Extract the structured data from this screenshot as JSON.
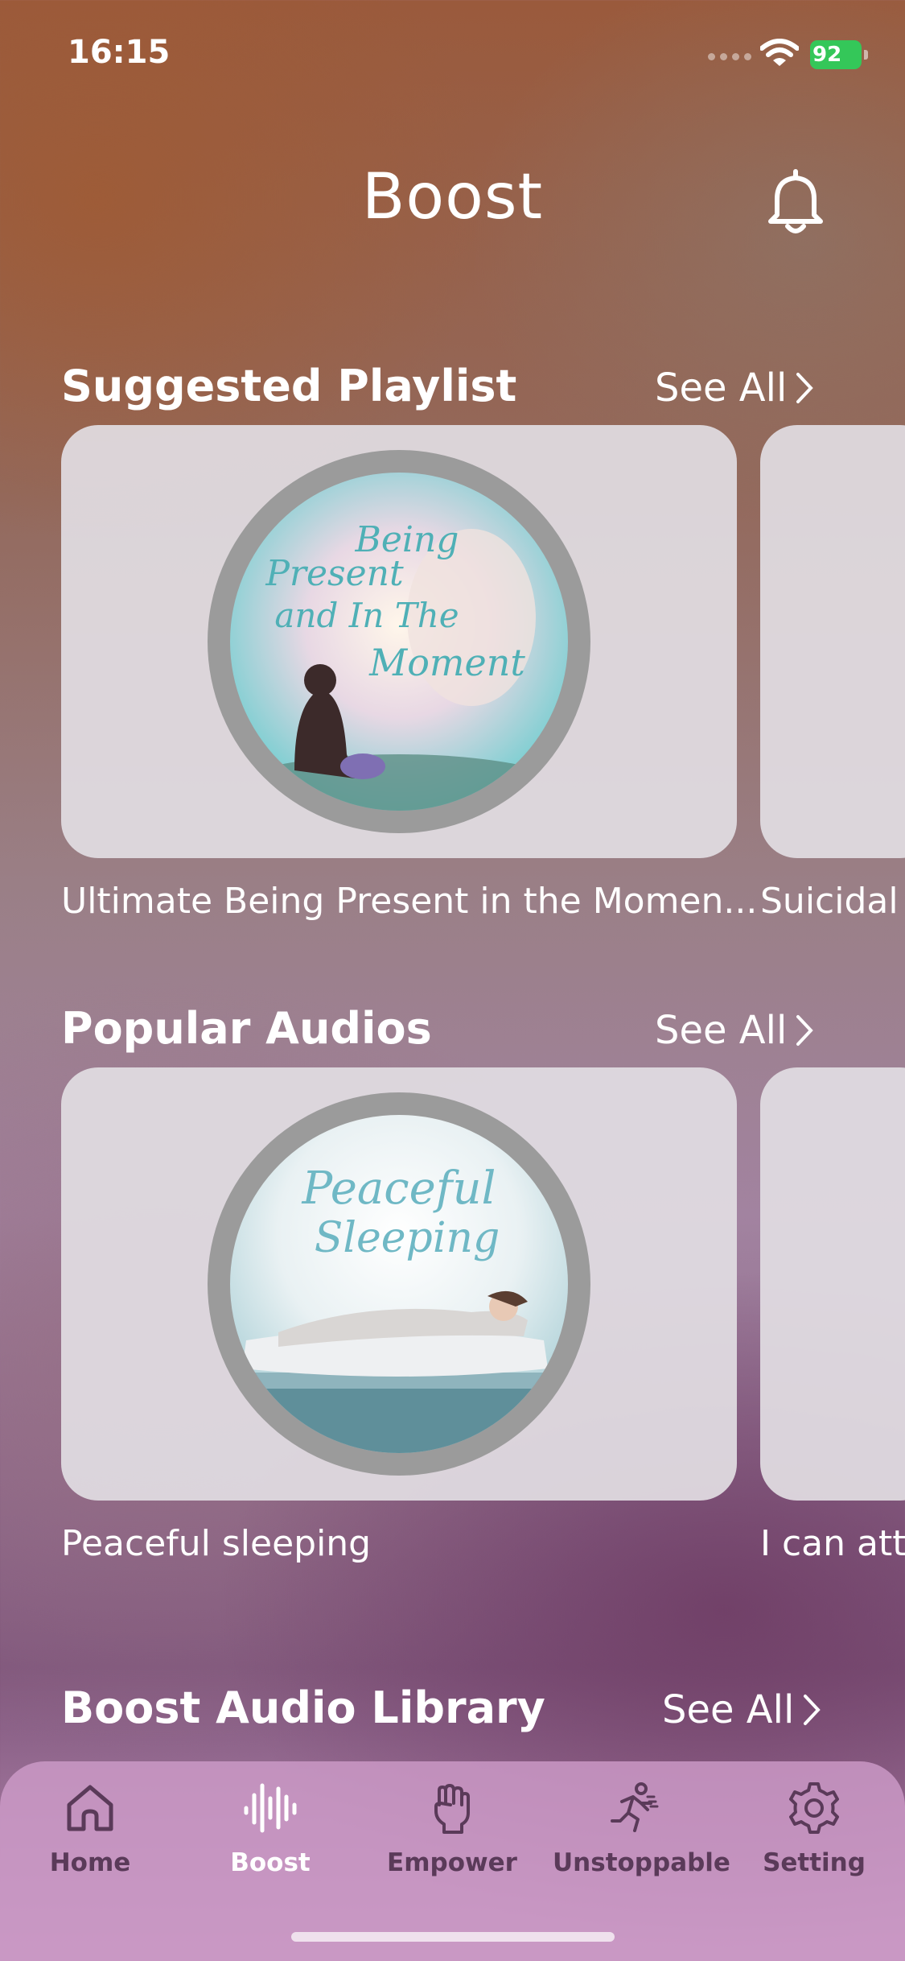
{
  "status_bar": {
    "time": "16:15",
    "battery_percent": "92"
  },
  "header": {
    "title": "Boost"
  },
  "sections": {
    "suggested": {
      "title": "Suggested Playlist",
      "see_all": "See All",
      "cards": [
        {
          "art_text": "Being Present and In The Moment",
          "caption": "Ultimate Being Present in the Momen..."
        },
        {
          "caption": "Suicidal"
        }
      ]
    },
    "popular": {
      "title": "Popular Audios",
      "see_all": "See All",
      "cards": [
        {
          "art_text": "Peaceful Sleeping",
          "caption": "Peaceful sleeping"
        },
        {
          "caption": "I can att"
        }
      ]
    },
    "library": {
      "title": "Boost Audio Library",
      "see_all": "See All"
    }
  },
  "tab_bar": {
    "items": [
      {
        "label": "Home",
        "icon": "home-icon"
      },
      {
        "label": "Boost",
        "icon": "sound-wave-icon",
        "active": true
      },
      {
        "label": "Empower",
        "icon": "raised-fist-icon"
      },
      {
        "label": "Unstoppable",
        "icon": "runner-icon"
      },
      {
        "label": "Setting",
        "icon": "gear-icon"
      }
    ]
  },
  "colors": {
    "battery": "#34c759",
    "tab_bar": "#cd9bc8",
    "tab_label": "#5a3a59",
    "card": "#e1dde2"
  }
}
